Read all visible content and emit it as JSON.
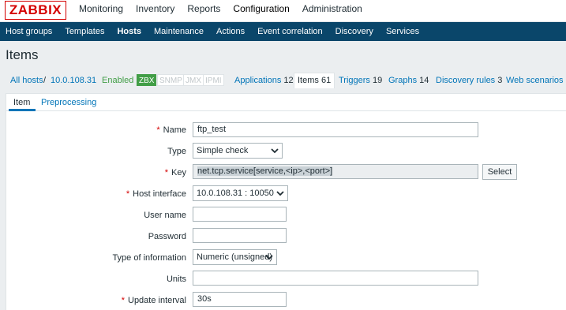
{
  "logo": "ZABBIX",
  "main_menu": [
    {
      "label": "Monitoring"
    },
    {
      "label": "Inventory"
    },
    {
      "label": "Reports"
    },
    {
      "label": "Configuration"
    },
    {
      "label": "Administration"
    }
  ],
  "sub_menu": [
    {
      "label": "Host groups"
    },
    {
      "label": "Templates"
    },
    {
      "label": "Hosts"
    },
    {
      "label": "Maintenance"
    },
    {
      "label": "Actions"
    },
    {
      "label": "Event correlation"
    },
    {
      "label": "Discovery"
    },
    {
      "label": "Services"
    }
  ],
  "page_title": "Items",
  "host_nav": {
    "all_hosts": "All hosts",
    "separator": "/",
    "host": "10.0.108.31",
    "status": "Enabled",
    "badges": [
      "ZBX",
      "SNMP",
      "JMX",
      "IPMI"
    ],
    "tabs": [
      {
        "label": "Applications",
        "count": "12"
      },
      {
        "label": "Items",
        "count": "61"
      },
      {
        "label": "Triggers",
        "count": "19"
      },
      {
        "label": "Graphs",
        "count": "14"
      },
      {
        "label": "Discovery rules",
        "count": "3"
      },
      {
        "label": "Web scenarios",
        "count": ""
      }
    ]
  },
  "form_tabs": [
    "Item",
    "Preprocessing"
  ],
  "form": {
    "name": {
      "label": "Name",
      "value": "ftp_test"
    },
    "type": {
      "label": "Type",
      "value": "Simple check"
    },
    "key": {
      "label": "Key",
      "value": "net.tcp.service[service,<ip>,<port>]",
      "button": "Select"
    },
    "host_interface": {
      "label": "Host interface",
      "value": "10.0.108.31 : 10050"
    },
    "user_name": {
      "label": "User name",
      "value": ""
    },
    "password": {
      "label": "Password",
      "value": ""
    },
    "type_of_information": {
      "label": "Type of information",
      "value": "Numeric (unsigned)"
    },
    "units": {
      "label": "Units",
      "value": ""
    },
    "update_interval": {
      "label": "Update interval",
      "value": "30s"
    }
  },
  "required_marker": "*",
  "colors": {
    "brand": "#d40000",
    "subnav": "#0a466a",
    "link": "#0275b8",
    "enabled": "#429e47"
  }
}
